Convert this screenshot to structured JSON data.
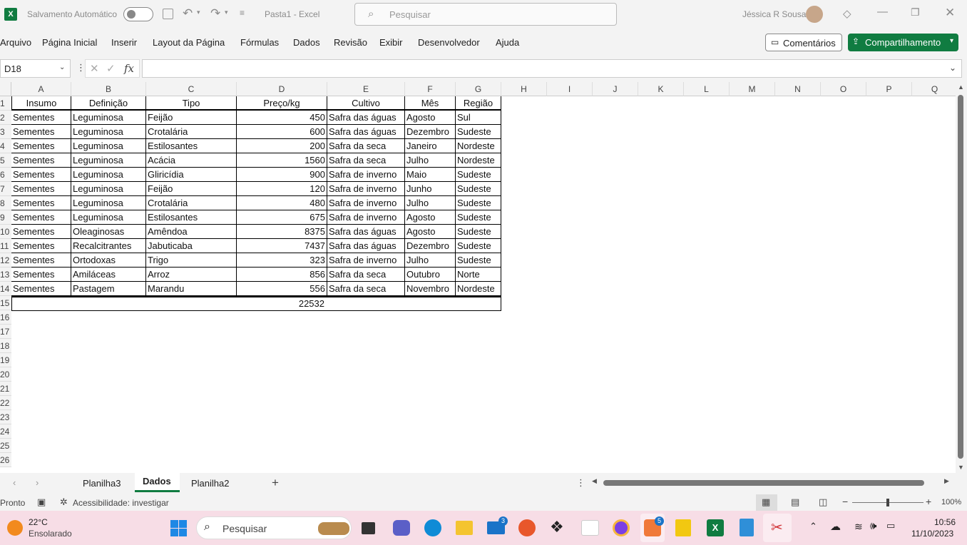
{
  "titlebar": {
    "autosave_label": "Salvamento Automático",
    "doc_title": "Pasta1 - Excel",
    "search_placeholder": "Pesquisar",
    "user_name": "Jéssica R Sousa"
  },
  "menu": {
    "items": [
      "Arquivo",
      "Página Inicial",
      "Inserir",
      "Layout da Página",
      "Fórmulas",
      "Dados",
      "Revisão",
      "Exibir",
      "Desenvolvedor",
      "Ajuda"
    ],
    "comments_label": "Comentários",
    "share_label": "Compartilhamento"
  },
  "formula_bar": {
    "name_box": "D18",
    "fx_label": "fx",
    "formula": ""
  },
  "columns": [
    "A",
    "B",
    "C",
    "D",
    "E",
    "F",
    "G",
    "H",
    "I",
    "J",
    "K",
    "L",
    "M",
    "N",
    "O",
    "P",
    "Q"
  ],
  "row_numbers": [
    "1",
    "2",
    "3",
    "4",
    "5",
    "6",
    "7",
    "8",
    "9",
    "10",
    "11",
    "12",
    "13",
    "14",
    "15",
    "16",
    "17",
    "18",
    "19",
    "20",
    "21",
    "22",
    "23",
    "24",
    "25",
    "26"
  ],
  "table": {
    "headers": [
      "Insumo",
      "Definição",
      "Tipo",
      "Preço/kg",
      "Cultivo",
      "Mês",
      "Região"
    ],
    "rows": [
      [
        "Sementes",
        "Leguminosa",
        "Feijão",
        "450",
        "Safra das águas",
        "Agosto",
        "Sul"
      ],
      [
        "Sementes",
        "Leguminosa",
        "Crotalária",
        "600",
        "Safra das águas",
        "Dezembro",
        "Sudeste"
      ],
      [
        "Sementes",
        "Leguminosa",
        "Estilosantes",
        "200",
        "Safra da seca",
        "Janeiro",
        "Nordeste"
      ],
      [
        "Sementes",
        "Leguminosa",
        "Acácia",
        "1560",
        "Safra da seca",
        "Julho",
        "Nordeste"
      ],
      [
        "Sementes",
        "Leguminosa",
        "Gliricídia",
        "900",
        "Safra de inverno",
        "Maio",
        "Sudeste"
      ],
      [
        "Sementes",
        "Leguminosa",
        "Feijão",
        "120",
        "Safra de inverno",
        "Junho",
        "Sudeste"
      ],
      [
        "Sementes",
        "Leguminosa",
        "Crotalária",
        "480",
        "Safra de inverno",
        "Julho",
        "Sudeste"
      ],
      [
        "Sementes",
        "Leguminosa",
        "Estilosantes",
        "675",
        "Safra de inverno",
        "Agosto",
        "Sudeste"
      ],
      [
        "Sementes",
        "Oleaginosas",
        "Amêndoa",
        "8375",
        "Safra das águas",
        "Agosto",
        "Sudeste"
      ],
      [
        "Sementes",
        "Recalcitrantes",
        "Jabuticaba",
        "7437",
        "Safra das águas",
        "Dezembro",
        "Sudeste"
      ],
      [
        "Sementes",
        "Ortodoxas",
        "Trigo",
        "323",
        "Safra de inverno",
        "Julho",
        "Sudeste"
      ],
      [
        "Sementes",
        "Amiláceas",
        "Arroz",
        "856",
        "Safra da seca",
        "Outubro",
        "Norte"
      ],
      [
        "Sementes",
        "Pastagem",
        "Marandu",
        "556",
        "Safra da seca",
        "Novembro",
        "Nordeste"
      ]
    ],
    "total": "22532"
  },
  "sheets": {
    "tabs": [
      "Planilha3",
      "Dados",
      "Planilha2"
    ],
    "active": "Dados",
    "add_label": "+"
  },
  "status": {
    "ready": "Pronto",
    "accessibility": "Acessibilidade: investigar",
    "zoom": "100%"
  },
  "taskbar": {
    "weather_temp": "22°C",
    "weather_desc": "Ensolarado",
    "search_placeholder": "Pesquisar",
    "time": "10:56",
    "date": "11/10/2023",
    "mail_badge": "3",
    "app_badge": "5"
  }
}
